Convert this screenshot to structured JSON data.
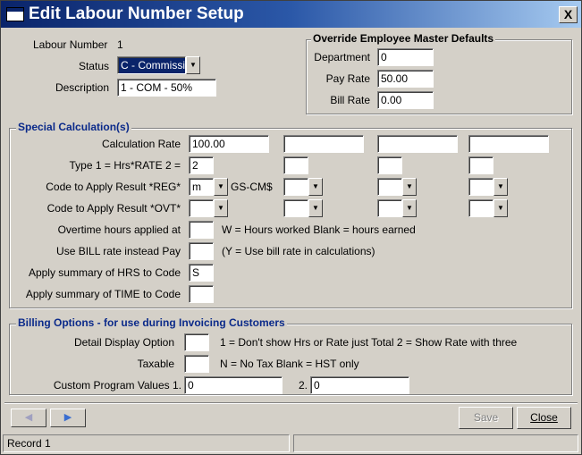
{
  "window": {
    "title": "Edit Labour Number Setup",
    "close_label": "X"
  },
  "header": {
    "labour_number_label": "Labour Number",
    "labour_number_value": "1",
    "status_label": "Status",
    "status_value": "C - Commissi",
    "description_label": "Description",
    "description_value": "1 - COM - 50%"
  },
  "override": {
    "title": "Override Employee Master Defaults",
    "department_label": "Department",
    "department_value": "0",
    "pay_rate_label": "Pay Rate",
    "pay_rate_value": "50.00",
    "bill_rate_label": "Bill Rate",
    "bill_rate_value": "0.00"
  },
  "special": {
    "title": "Special Calculation(s)",
    "calc_rate_label": "Calculation Rate",
    "calc_rate_values": [
      "100.00",
      "",
      "",
      ""
    ],
    "type_label": "Type 1 = Hrs*RATE  2 =",
    "type_values": [
      "2",
      "",
      "",
      ""
    ],
    "reg_label": "Code to Apply Result *REG*",
    "reg_values": [
      "m",
      "",
      "",
      ""
    ],
    "reg_code_text": "GS-CM$",
    "ovt_label": "Code to Apply Result *OVT*",
    "ovt_values": [
      "",
      "",
      "",
      ""
    ],
    "overtime_label": "Overtime hours applied at",
    "overtime_value": "",
    "overtime_hint": "W = Hours worked   Blank = hours earned",
    "bill_rate_label": "Use BILL rate instead Pay",
    "bill_rate_value": "",
    "bill_rate_hint": "(Y = Use bill rate in calculations)",
    "hrs_summary_label": "Apply summary of HRS to Code",
    "hrs_summary_value": "S",
    "time_summary_label": "Apply summary of TIME to Code",
    "time_summary_value": ""
  },
  "billing": {
    "title": "Billing Options - for use during Invoicing Customers",
    "detail_label": "Detail Display Option",
    "detail_value": "",
    "detail_hint": "1 = Don't show Hrs or Rate just Total   2 = Show Rate with three",
    "taxable_label": "Taxable",
    "taxable_value": "",
    "taxable_hint": "N = No Tax   Blank = HST only",
    "custom_label": "Custom Program Values  1.",
    "custom1_value": "0",
    "custom2_label": "2.",
    "custom2_value": "0"
  },
  "buttons": {
    "save": "Save",
    "close": "Close",
    "prev_icon": "◀",
    "next_icon": "▶"
  },
  "status": {
    "record": "Record 1"
  }
}
